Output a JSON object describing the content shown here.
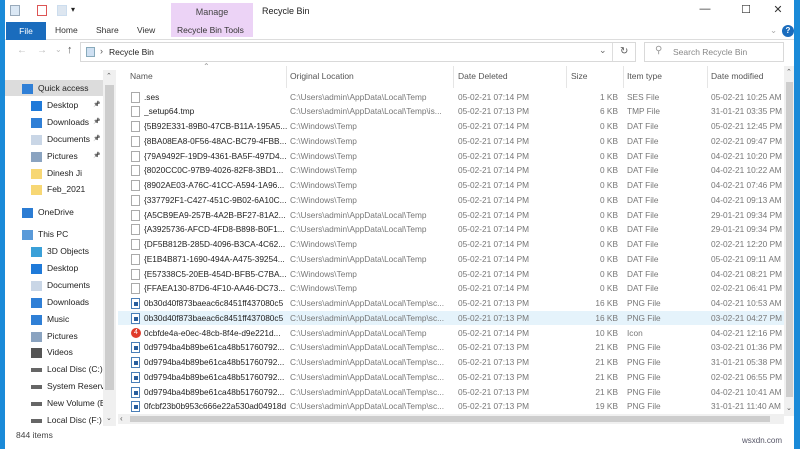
{
  "window": {
    "title": "Recycle Bin",
    "context_tab": "Manage",
    "context_subtab": "Recycle Bin Tools",
    "minimize": "—",
    "maximize": "☐",
    "close": "✕",
    "help": "?"
  },
  "ribbon": {
    "tabs": [
      "File",
      "Home",
      "Share",
      "View"
    ]
  },
  "address": {
    "path": "Recycle Bin",
    "separator": "›",
    "back": "←",
    "forward": "→",
    "recent": "⌄",
    "up": "↑",
    "refresh": "↻",
    "dropdown": "⌄"
  },
  "search": {
    "placeholder": "Search Recycle Bin"
  },
  "sidebar": {
    "items": [
      {
        "label": "Quick access",
        "icon": "star-icon",
        "level": 0
      },
      {
        "label": "Desktop",
        "icon": "desktop-icon",
        "level": 1,
        "pinned": true
      },
      {
        "label": "Downloads",
        "icon": "download-icon",
        "level": 1,
        "pinned": true
      },
      {
        "label": "Documents",
        "icon": "document-icon",
        "level": 1,
        "pinned": true
      },
      {
        "label": "Pictures",
        "icon": "pictures-icon",
        "level": 1,
        "pinned": true
      },
      {
        "label": "Dinesh Ji",
        "icon": "folder-icon",
        "level": 1
      },
      {
        "label": "Feb_2021",
        "icon": "folder-icon",
        "level": 1
      },
      {
        "label": "OneDrive",
        "icon": "cloud-icon",
        "level": 0
      },
      {
        "label": "This PC",
        "icon": "computer-icon",
        "level": 0
      },
      {
        "label": "3D Objects",
        "icon": "cube-icon",
        "level": 1
      },
      {
        "label": "Desktop",
        "icon": "desktop-icon",
        "level": 1
      },
      {
        "label": "Documents",
        "icon": "document-icon",
        "level": 1
      },
      {
        "label": "Downloads",
        "icon": "download-icon",
        "level": 1
      },
      {
        "label": "Music",
        "icon": "music-icon",
        "level": 1
      },
      {
        "label": "Pictures",
        "icon": "pictures-icon",
        "level": 1
      },
      {
        "label": "Videos",
        "icon": "video-icon",
        "level": 1
      },
      {
        "label": "Local Disc (C:)",
        "icon": "drive-icon",
        "level": 1
      },
      {
        "label": "System Reserved",
        "icon": "drive-icon",
        "level": 1
      },
      {
        "label": "New Volume (E:)",
        "icon": "drive-icon",
        "level": 1
      },
      {
        "label": "Local Disc (F:)",
        "icon": "drive-icon",
        "level": 1
      }
    ]
  },
  "columns": [
    "Name",
    "Original Location",
    "Date Deleted",
    "Size",
    "Item type",
    "Date modified"
  ],
  "files": [
    {
      "name": ".ses",
      "loc": "C:\\Users\\admin\\AppData\\Local\\Temp",
      "deleted": "05-02-21 07:14 PM",
      "size": "1 KB",
      "type": "SES File",
      "modified": "05-02-21 10:25 AM",
      "icon": "file"
    },
    {
      "name": "_setup64.tmp",
      "loc": "C:\\Users\\admin\\AppData\\Local\\Temp\\is...",
      "deleted": "05-02-21 07:13 PM",
      "size": "6 KB",
      "type": "TMP File",
      "modified": "31-01-21 03:35 PM",
      "icon": "file"
    },
    {
      "name": "{5B92E331-89B0-47CB-B11A-195A5...",
      "loc": "C:\\Windows\\Temp",
      "deleted": "05-02-21 07:14 PM",
      "size": "0 KB",
      "type": "DAT File",
      "modified": "05-02-21 12:45 PM",
      "icon": "file"
    },
    {
      "name": "{8BA08EA8-0F56-48AC-BC79-4FBB...",
      "loc": "C:\\Windows\\Temp",
      "deleted": "05-02-21 07:14 PM",
      "size": "0 KB",
      "type": "DAT File",
      "modified": "02-02-21 09:47 PM",
      "icon": "file"
    },
    {
      "name": "{79A9492F-19D9-4361-BA5F-497D4...",
      "loc": "C:\\Windows\\Temp",
      "deleted": "05-02-21 07:14 PM",
      "size": "0 KB",
      "type": "DAT File",
      "modified": "04-02-21 10:20 PM",
      "icon": "file"
    },
    {
      "name": "{8020CC0C-97B9-4026-82F8-3BD1...",
      "loc": "C:\\Windows\\Temp",
      "deleted": "05-02-21 07:14 PM",
      "size": "0 KB",
      "type": "DAT File",
      "modified": "04-02-21 10:22 AM",
      "icon": "file"
    },
    {
      "name": "{8902AE03-A76C-41CC-A594-1A96...",
      "loc": "C:\\Windows\\Temp",
      "deleted": "05-02-21 07:14 PM",
      "size": "0 KB",
      "type": "DAT File",
      "modified": "04-02-21 07:46 PM",
      "icon": "file"
    },
    {
      "name": "{337792F1-C427-451C-9B02-6A10C...",
      "loc": "C:\\Windows\\Temp",
      "deleted": "05-02-21 07:14 PM",
      "size": "0 KB",
      "type": "DAT File",
      "modified": "04-02-21 09:13 AM",
      "icon": "file"
    },
    {
      "name": "{A5CB9EA9-257B-4A2B-BF27-81A2...",
      "loc": "C:\\Users\\admin\\AppData\\Local\\Temp",
      "deleted": "05-02-21 07:14 PM",
      "size": "0 KB",
      "type": "DAT File",
      "modified": "29-01-21 09:34 PM",
      "icon": "file"
    },
    {
      "name": "{A3925736-AFCD-4FD8-B898-B0F1...",
      "loc": "C:\\Users\\admin\\AppData\\Local\\Temp",
      "deleted": "05-02-21 07:14 PM",
      "size": "0 KB",
      "type": "DAT File",
      "modified": "29-01-21 09:34 PM",
      "icon": "file"
    },
    {
      "name": "{DF5B812B-285D-4096-B3CA-4C62...",
      "loc": "C:\\Windows\\Temp",
      "deleted": "05-02-21 07:14 PM",
      "size": "0 KB",
      "type": "DAT File",
      "modified": "02-02-21 12:20 PM",
      "icon": "file"
    },
    {
      "name": "{E1B4B871-1690-494A-A475-39254...",
      "loc": "C:\\Users\\admin\\AppData\\Local\\Temp",
      "deleted": "05-02-21 07:14 PM",
      "size": "0 KB",
      "type": "DAT File",
      "modified": "05-02-21 09:11 AM",
      "icon": "file"
    },
    {
      "name": "{E57338C5-20EB-454D-BFB5-C7BA...",
      "loc": "C:\\Windows\\Temp",
      "deleted": "05-02-21 07:14 PM",
      "size": "0 KB",
      "type": "DAT File",
      "modified": "04-02-21 08:21 PM",
      "icon": "file"
    },
    {
      "name": "{FFAEA130-87D6-4F10-AA46-DC73...",
      "loc": "C:\\Windows\\Temp",
      "deleted": "05-02-21 07:14 PM",
      "size": "0 KB",
      "type": "DAT File",
      "modified": "02-02-21 06:41 PM",
      "icon": "file"
    },
    {
      "name": "0b30d40f873baeac6c8451ff437080c5",
      "loc": "C:\\Users\\admin\\AppData\\Local\\Temp\\sc...",
      "deleted": "05-02-21 07:13 PM",
      "size": "16 KB",
      "type": "PNG File",
      "modified": "04-02-21 10:53 AM",
      "icon": "png"
    },
    {
      "name": "0b30d40f873baeac6c8451ff437080c5",
      "loc": "C:\\Users\\admin\\AppData\\Local\\Temp\\sc...",
      "deleted": "05-02-21 07:13 PM",
      "size": "16 KB",
      "type": "PNG File",
      "modified": "03-02-21 04:27 PM",
      "icon": "png",
      "hover": true
    },
    {
      "name": "0cbfde4a-e0ec-48cb-8f4e-d9e221d...",
      "loc": "C:\\Users\\admin\\AppData\\Local\\Temp",
      "deleted": "05-02-21 07:14 PM",
      "size": "10 KB",
      "type": "Icon",
      "modified": "04-02-21 12:16 PM",
      "icon": "ico"
    },
    {
      "name": "0d9794ba4b89be61ca48b51760792...",
      "loc": "C:\\Users\\admin\\AppData\\Local\\Temp\\sc...",
      "deleted": "05-02-21 07:13 PM",
      "size": "21 KB",
      "type": "PNG File",
      "modified": "03-02-21 01:36 PM",
      "icon": "png"
    },
    {
      "name": "0d9794ba4b89be61ca48b51760792...",
      "loc": "C:\\Users\\admin\\AppData\\Local\\Temp\\sc...",
      "deleted": "05-02-21 07:13 PM",
      "size": "21 KB",
      "type": "PNG File",
      "modified": "31-01-21 05:38 PM",
      "icon": "png"
    },
    {
      "name": "0d9794ba4b89be61ca48b51760792...",
      "loc": "C:\\Users\\admin\\AppData\\Local\\Temp\\sc...",
      "deleted": "05-02-21 07:13 PM",
      "size": "21 KB",
      "type": "PNG File",
      "modified": "02-02-21 06:55 PM",
      "icon": "png"
    },
    {
      "name": "0d9794ba4b89be61ca48b51760792...",
      "loc": "C:\\Users\\admin\\AppData\\Local\\Temp\\sc...",
      "deleted": "05-02-21 07:13 PM",
      "size": "21 KB",
      "type": "PNG File",
      "modified": "04-02-21 10:41 AM",
      "icon": "png"
    },
    {
      "name": "0fcbf23b0b953c666e22a530ad04918d",
      "loc": "C:\\Users\\admin\\AppData\\Local\\Temp\\sc...",
      "deleted": "05-02-21 07:13 PM",
      "size": "19 KB",
      "type": "PNG File",
      "modified": "31-01-21 11:40 AM",
      "icon": "png"
    }
  ],
  "status": {
    "count": "844 items"
  },
  "watermark": "wsxdn.com",
  "colors": {
    "accent": "#1a6cbd",
    "manage_tab": "#ecd3f6",
    "hover_row": "#e5f3fb"
  }
}
